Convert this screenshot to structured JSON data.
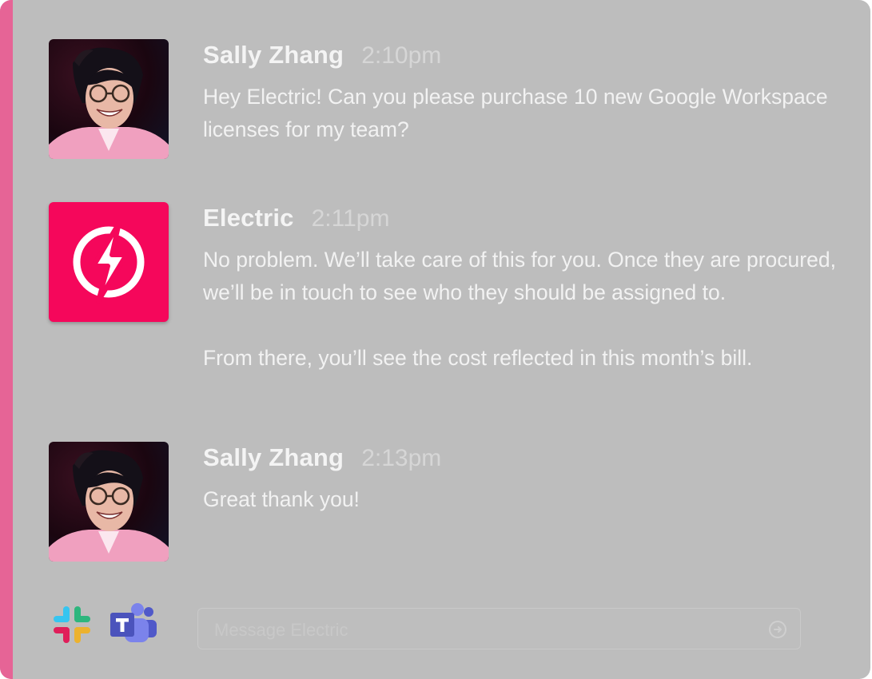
{
  "messages": [
    {
      "sender": "Sally Zhang",
      "time": "2:10pm",
      "avatar": "user-photo",
      "paragraphs": [
        "Hey Electric! Can you please purchase 10 new Google Workspace licenses for my team?"
      ]
    },
    {
      "sender": "Electric",
      "time": "2:11pm",
      "avatar": "electric-bolt-logo",
      "paragraphs": [
        "No problem. We’ll take care of this for you. Once they are procured, we’ll be in touch to see who they should be assigned to.",
        "From there, you’ll see the cost reflected in this month’s bill."
      ]
    },
    {
      "sender": "Sally Zhang",
      "time": "2:13pm",
      "avatar": "user-photo",
      "paragraphs": [
        "Great thank you!"
      ]
    }
  ],
  "composer": {
    "placeholder": "Message Electric",
    "value": ""
  },
  "integrations": [
    {
      "icon": "slack-icon"
    },
    {
      "icon": "teams-icon"
    }
  ],
  "colors": {
    "accent": "#e66496",
    "brand": "#f5075b",
    "panel": "#bdbdbd"
  }
}
